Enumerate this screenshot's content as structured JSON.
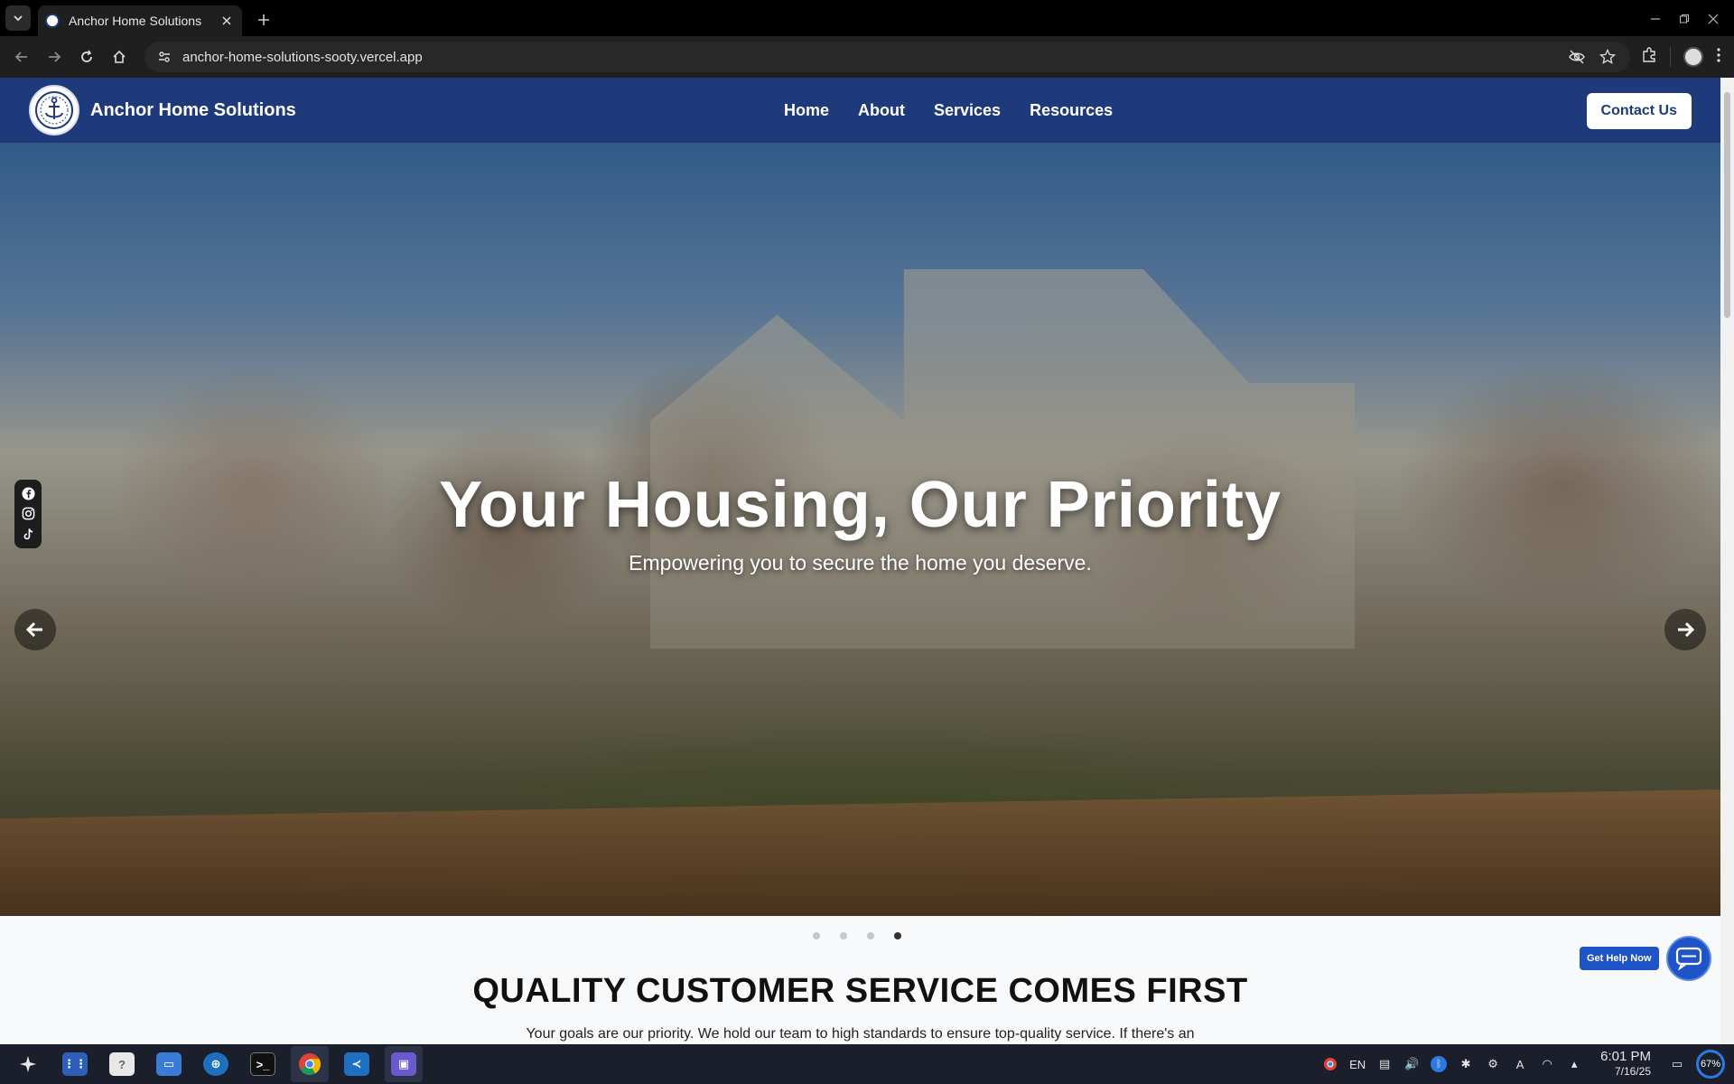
{
  "browser": {
    "tab_title": "Anchor Home Solutions",
    "url": "anchor-home-solutions-sooty.vercel.app"
  },
  "header": {
    "brand": "Anchor Home Solutions",
    "nav": [
      "Home",
      "About",
      "Services",
      "Resources"
    ],
    "contact_label": "Contact Us"
  },
  "hero": {
    "title": "Your Housing, Our Priority",
    "subtitle": "Empowering you to secure the home you deserve.",
    "slide_count": 4,
    "active_slide": 4
  },
  "social": [
    "facebook-icon",
    "instagram-icon",
    "tiktok-icon"
  ],
  "help": {
    "label": "Get Help Now"
  },
  "section": {
    "title": "QUALITY CUSTOMER SERVICE COMES FIRST",
    "text": "Your goals are our priority. We hold our team to high standards to ensure top-quality service. If there's an"
  },
  "taskbar": {
    "time": "6:01 PM",
    "date": "7/16/25",
    "lang": "EN",
    "battery": "67%"
  },
  "colors": {
    "header_bg": "#1e3a7a",
    "accent_blue": "#1e54c6"
  }
}
